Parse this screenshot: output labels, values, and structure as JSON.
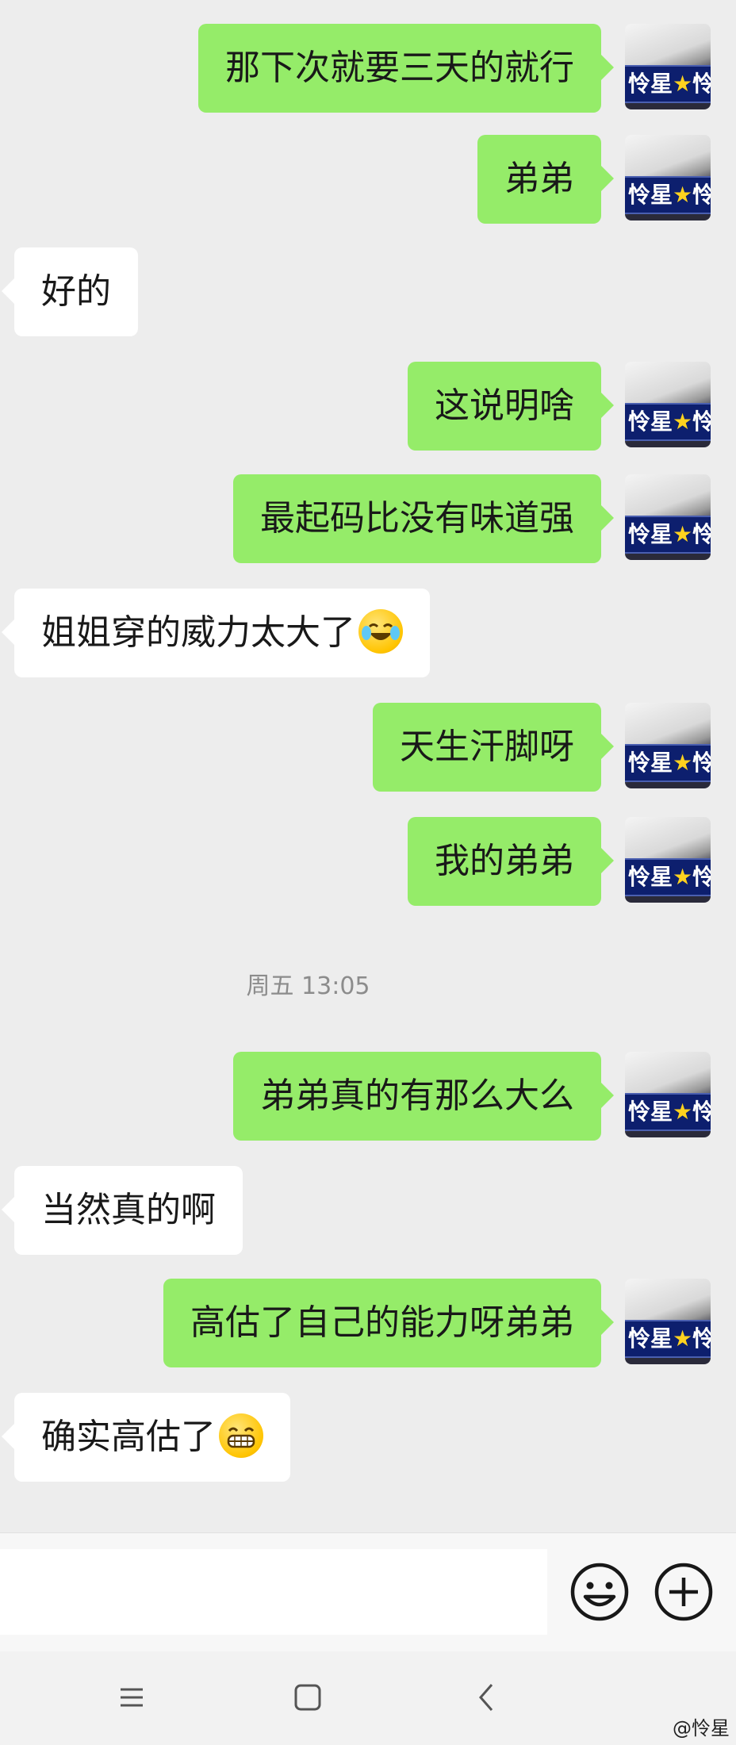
{
  "messages": [
    {
      "side": "out",
      "text": "那下次就要三天的就行"
    },
    {
      "side": "out",
      "text": "弟弟"
    },
    {
      "side": "in",
      "text": "好的"
    },
    {
      "side": "out",
      "text": "这说明啥"
    },
    {
      "side": "out",
      "text": "最起码比没有味道强"
    },
    {
      "side": "in",
      "text": "姐姐穿的威力太大了",
      "emoji": "laughing-crying-emoji"
    },
    {
      "side": "out",
      "text": "天生汗脚呀"
    },
    {
      "side": "out",
      "text": "我的弟弟"
    },
    {
      "side": "out",
      "text": "弟弟真的有那么大么"
    },
    {
      "side": "in",
      "text": "当然真的啊"
    },
    {
      "side": "out",
      "text": "高估了自己的能力呀弟弟"
    },
    {
      "side": "in",
      "text": "确实高估了",
      "emoji": "grinning-emoji"
    }
  ],
  "timestamp": "周五 13:05",
  "avatar": {
    "name": "怜星",
    "star": "★",
    "suffix": "怜"
  },
  "input": {
    "value": "",
    "placeholder": ""
  },
  "icons": {
    "emoji_button": "smiley-icon",
    "plus_button": "plus-circle-icon"
  },
  "nav": {
    "menu": "menu-icon",
    "home": "home-square-icon",
    "back": "back-chevron-icon"
  },
  "watermark": "@怜星",
  "colors": {
    "outgoing": "#95ec69",
    "incoming": "#ffffff",
    "background": "#ededed"
  }
}
